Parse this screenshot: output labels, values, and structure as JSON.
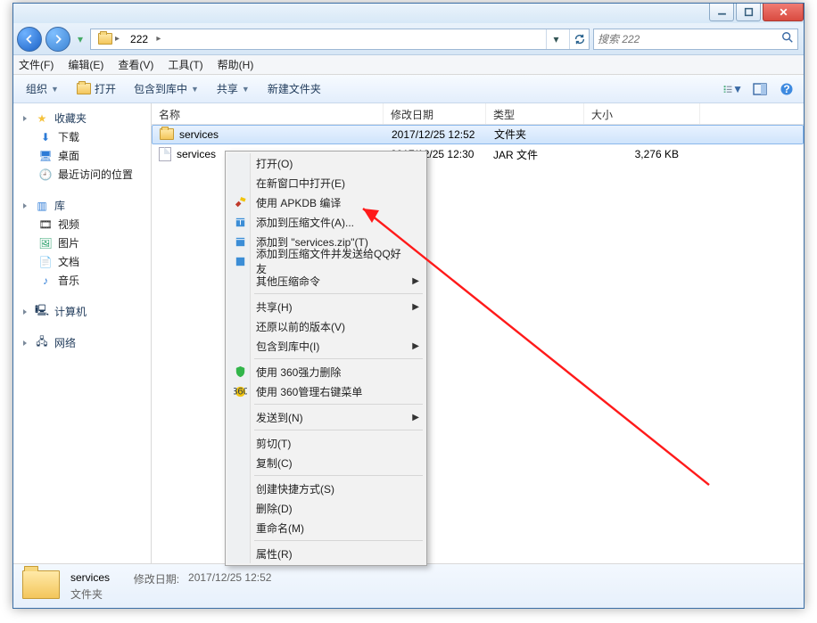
{
  "titlebar": {
    "min": "–",
    "max": "▯",
    "close": "✕"
  },
  "nav": {
    "crumb_root_icon": "computer",
    "crumb_folder": "222",
    "refresh_title": "刷新",
    "search_placeholder": "搜索 222"
  },
  "menubar": {
    "file": "文件(F)",
    "edit": "编辑(E)",
    "view": "查看(V)",
    "tools": "工具(T)",
    "help": "帮助(H)"
  },
  "toolbar": {
    "organize": "组织",
    "open": "打开",
    "include": "包含到库中",
    "share": "共享",
    "newfolder": "新建文件夹"
  },
  "tree": {
    "favorites": {
      "label": "收藏夹",
      "items": [
        "下载",
        "桌面",
        "最近访问的位置"
      ]
    },
    "libraries": {
      "label": "库",
      "items": [
        "视频",
        "图片",
        "文档",
        "音乐"
      ]
    },
    "computer": {
      "label": "计算机"
    },
    "network": {
      "label": "网络"
    }
  },
  "columns": {
    "name": "名称",
    "date": "修改日期",
    "type": "类型",
    "size": "大小"
  },
  "rows": [
    {
      "name": "services",
      "date": "2017/12/25 12:52",
      "type": "文件夹",
      "size": "",
      "icon": "folder",
      "selected": true
    },
    {
      "name": "services",
      "date": "2017/12/25 12:30",
      "type": "JAR 文件",
      "size": "3,276 KB",
      "icon": "file",
      "selected": false
    }
  ],
  "ctx": {
    "open": "打开(O)",
    "open_new_window": "在新窗口中打开(E)",
    "apkdb": "使用 APKDB 编译",
    "add_archive": "添加到压缩文件(A)...",
    "add_zip": "添加到 \"services.zip\"(T)",
    "add_send_qq": "添加到压缩文件并发送给QQ好友",
    "other_compress": "其他压缩命令",
    "share": "共享(H)",
    "restore": "还原以前的版本(V)",
    "include_lib": "包含到库中(I)",
    "force_delete_360": "使用 360强力删除",
    "manage_menu_360": "使用 360管理右键菜单",
    "send_to": "发送到(N)",
    "cut": "剪切(T)",
    "copy": "复制(C)",
    "create_shortcut": "创建快捷方式(S)",
    "delete": "删除(D)",
    "rename": "重命名(M)",
    "properties": "属性(R)"
  },
  "details": {
    "name": "services",
    "date_label": "修改日期:",
    "date": "2017/12/25 12:52",
    "type": "文件夹"
  }
}
